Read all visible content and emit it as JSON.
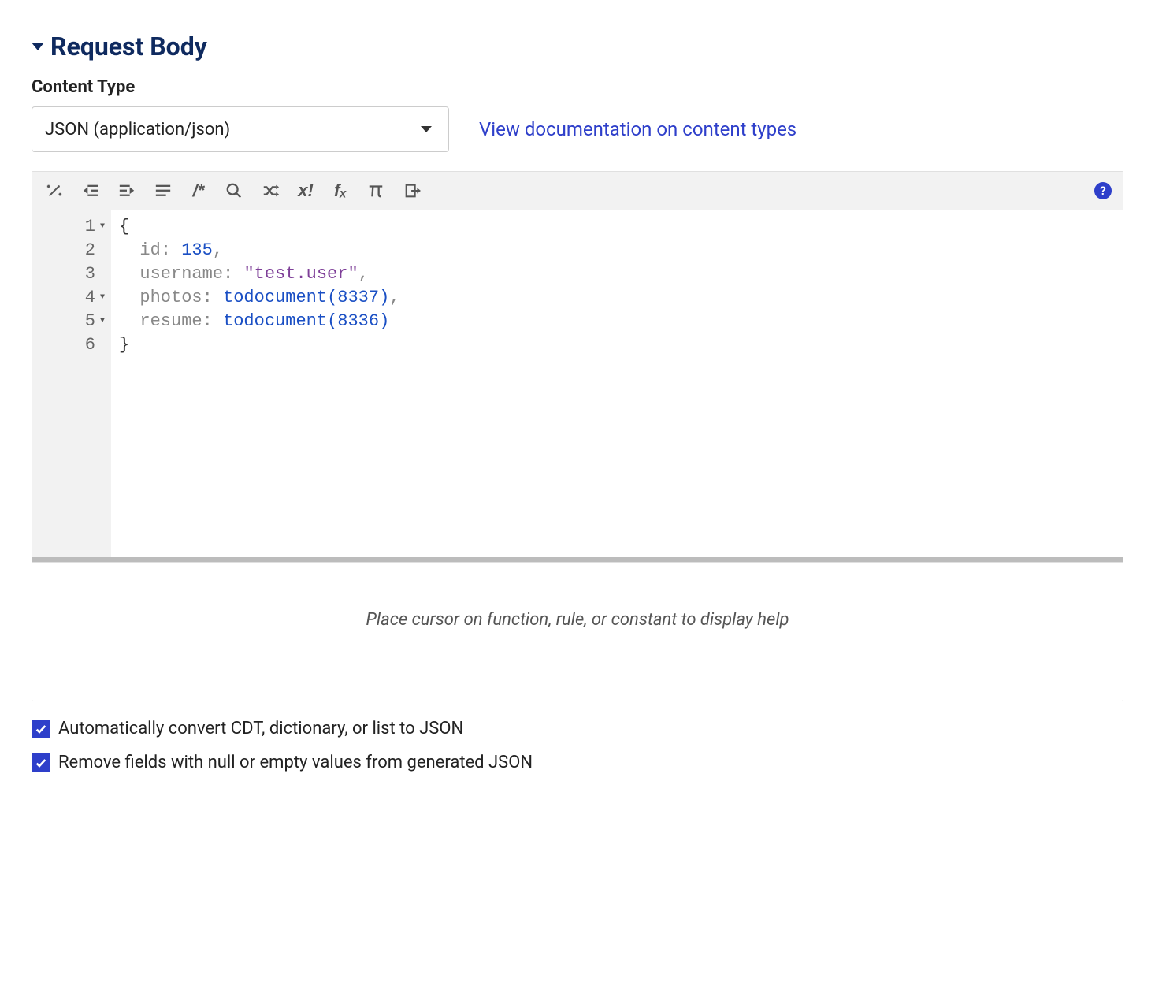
{
  "section": {
    "title": "Request Body"
  },
  "contentType": {
    "label": "Content Type",
    "selected": "JSON (application/json)"
  },
  "links": {
    "contentTypesDoc": "View documentation on content types"
  },
  "toolbar": {
    "help_glyph": "?",
    "comment_label": "/*",
    "x_excl_label": "x!",
    "fx_label": "fₓ"
  },
  "editor": {
    "lines": [
      {
        "num": "1",
        "fold": true
      },
      {
        "num": "2",
        "fold": false
      },
      {
        "num": "3",
        "fold": false
      },
      {
        "num": "4",
        "fold": true
      },
      {
        "num": "5",
        "fold": true
      },
      {
        "num": "6",
        "fold": false
      }
    ],
    "code": {
      "line2": {
        "key": "id",
        "value_num": "135"
      },
      "line3": {
        "key": "username",
        "value_str": "\"test.user\""
      },
      "line4": {
        "key": "photos",
        "fn": "todocument",
        "arg": "8337"
      },
      "line5": {
        "key": "resume",
        "fn": "todocument",
        "arg": "8336"
      }
    }
  },
  "hint": "Place cursor on function, rule, or constant to display help",
  "checkboxes": {
    "autoConvert": "Automatically convert CDT, dictionary, or list to JSON",
    "removeNull": "Remove fields with null or empty values from generated JSON"
  }
}
